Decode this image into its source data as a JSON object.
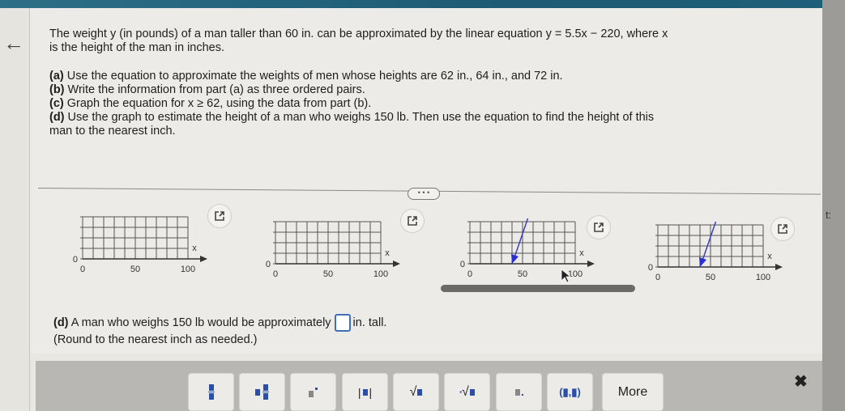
{
  "nav": {
    "back_icon": "arrow-left-icon",
    "back_glyph": "←"
  },
  "question": {
    "intro_line1_pre": "The weight y (in pounds) of a man taller than 60 in. can be approximated by the linear equation ",
    "equation": "y = 5.5x − 220",
    "intro_line1_post": ", where x",
    "intro_line2": "is the height of the man in inches.",
    "parts": [
      {
        "label": "(a)",
        "text": " Use the equation to approximate the weights of men whose heights are 62 in., 64 in., and 72 in."
      },
      {
        "label": "(b)",
        "text": " Write the information from part (a) as three ordered pairs."
      },
      {
        "label": "(c)",
        "text": " Graph the equation for x ≥ 62, using the data from part (b)."
      },
      {
        "label": "(d)",
        "text": " Use the graph to estimate the height of a man who weighs 150 lb. Then use the equation to find the height of this",
        "text2": "man to the nearest inch."
      }
    ]
  },
  "divider": {
    "more_label": "• • •"
  },
  "graph_options": [
    {
      "id": "A",
      "x_ticks": [
        "0",
        "50",
        "100"
      ],
      "y_origin": "0",
      "x_axis_label": "x",
      "has_line": false,
      "popout_icon": "popout-icon"
    },
    {
      "id": "B",
      "x_ticks": [
        "0",
        "50",
        "100"
      ],
      "y_origin": "0",
      "x_axis_label": "x",
      "has_line": false,
      "popout_icon": "popout-icon"
    },
    {
      "id": "C",
      "x_ticks": [
        "0",
        "50",
        "100"
      ],
      "y_origin": "0",
      "x_axis_label": "x",
      "has_line": true,
      "line_color": "#3a3fbf",
      "popout_icon": "popout-icon"
    },
    {
      "id": "D",
      "x_ticks": [
        "0",
        "50",
        "100"
      ],
      "y_origin": "0",
      "x_axis_label": "x",
      "has_line": true,
      "line_color": "#3a3fbf",
      "popout_icon": "popout-icon"
    }
  ],
  "answer": {
    "label": "(d)",
    "text_pre": " A man who weighs 150 lb would be approximately",
    "input_value": "",
    "text_post": "in. tall.",
    "hint": "(Round to the nearest inch as needed.)"
  },
  "toolbar": {
    "buttons": [
      {
        "name": "fraction-button",
        "icon": "fraction-icon"
      },
      {
        "name": "mixed-number-button",
        "icon": "mixed-number-icon"
      },
      {
        "name": "exponent-button",
        "icon": "exponent-icon"
      },
      {
        "name": "absolute-value-button",
        "icon": "absolute-value-icon"
      },
      {
        "name": "square-root-button",
        "icon": "square-root-icon"
      },
      {
        "name": "nth-root-button",
        "icon": "nth-root-icon"
      },
      {
        "name": "decimal-button",
        "icon": "decimal-icon"
      },
      {
        "name": "ordered-pair-button",
        "icon": "ordered-pair-icon",
        "label": "(▮,▮)"
      }
    ],
    "more_label": "More",
    "close_glyph": "✖"
  },
  "colors": {
    "accent": "#2a4fa8",
    "header": "#1d5a74",
    "answer_box": "#3f6fb8"
  },
  "right_edge_fragment": "t:"
}
